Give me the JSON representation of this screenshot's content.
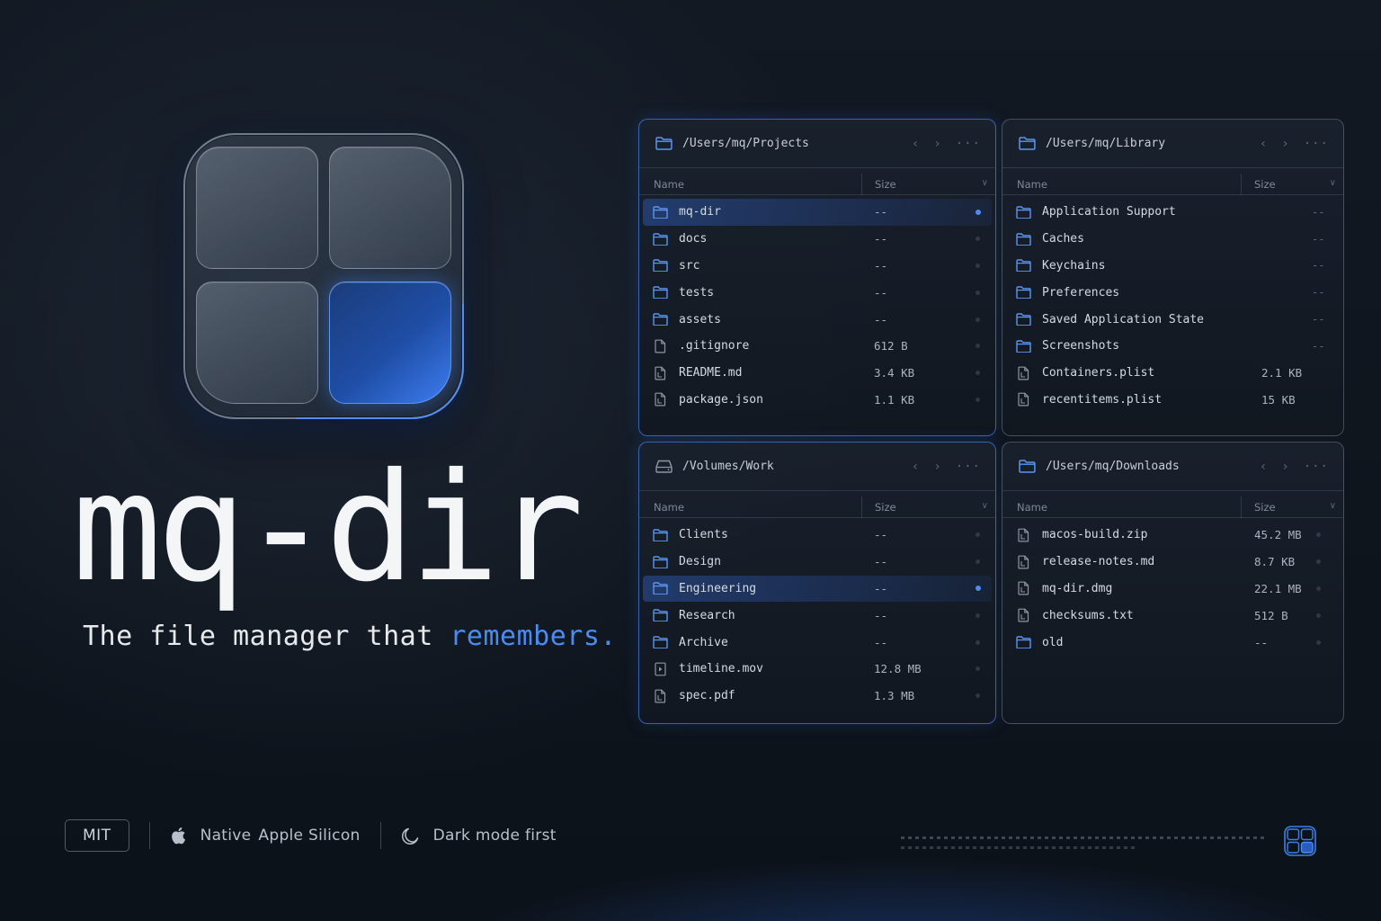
{
  "brand": {
    "name": "mq-dir",
    "tagline_prefix": "The file manager that ",
    "tagline_accent": "remembers."
  },
  "footer": {
    "license_badge": "MIT",
    "feature_1_a": "Native",
    "feature_1_b": "Apple Silicon",
    "feature_2": "Dark mode first"
  },
  "columns": {
    "name": "Name",
    "size": "Size"
  },
  "panes": [
    {
      "path": "/Users/mq/Projects",
      "icon": "folder-icon",
      "active": true,
      "rows": [
        {
          "name": "mq-dir",
          "size": "--",
          "kind": "folder",
          "selected": true
        },
        {
          "name": "docs",
          "size": "--",
          "kind": "folder"
        },
        {
          "name": "src",
          "size": "--",
          "kind": "folder"
        },
        {
          "name": "tests",
          "size": "--",
          "kind": "folder"
        },
        {
          "name": "assets",
          "size": "--",
          "kind": "folder"
        },
        {
          "name": ".gitignore",
          "size": "612 B",
          "kind": "file"
        },
        {
          "name": "README.md",
          "size": "3.4 KB",
          "kind": "doc"
        },
        {
          "name": "package.json",
          "size": "1.1 KB",
          "kind": "doc"
        }
      ]
    },
    {
      "path": "/Users/mq/Library",
      "icon": "folder-icon",
      "active": false,
      "rows": [
        {
          "name": "Application Support",
          "size": "--",
          "kind": "folder"
        },
        {
          "name": "Caches",
          "size": "--",
          "kind": "folder"
        },
        {
          "name": "Keychains",
          "size": "--",
          "kind": "folder"
        },
        {
          "name": "Preferences",
          "size": "--",
          "kind": "folder"
        },
        {
          "name": "Saved Application State",
          "size": "--",
          "kind": "folder"
        },
        {
          "name": "Screenshots",
          "size": "--",
          "kind": "folder"
        },
        {
          "name": "Containers.plist",
          "size": "2.1 KB",
          "kind": "doc"
        },
        {
          "name": "recentitems.plist",
          "size": "15 KB",
          "kind": "doc"
        }
      ]
    },
    {
      "path": "/Volumes/Work",
      "icon": "drive-icon",
      "active": true,
      "rows": [
        {
          "name": "Clients",
          "size": "--",
          "kind": "folder"
        },
        {
          "name": "Design",
          "size": "--",
          "kind": "folder"
        },
        {
          "name": "Engineering",
          "size": "--",
          "kind": "folder",
          "selected": true
        },
        {
          "name": "Research",
          "size": "--",
          "kind": "folder"
        },
        {
          "name": "Archive",
          "size": "--",
          "kind": "folder"
        },
        {
          "name": "timeline.mov",
          "size": "12.8 MB",
          "kind": "video"
        },
        {
          "name": "spec.pdf",
          "size": "1.3 MB",
          "kind": "doc"
        }
      ]
    },
    {
      "path": "/Users/mq/Downloads",
      "icon": "folder-icon",
      "active": false,
      "rows": [
        {
          "name": "macos-build.zip",
          "size": "45.2 MB",
          "kind": "doc"
        },
        {
          "name": "release-notes.md",
          "size": "8.7 KB",
          "kind": "doc"
        },
        {
          "name": "mq-dir.dmg",
          "size": "22.1 MB",
          "kind": "doc"
        },
        {
          "name": "checksums.txt",
          "size": "512 B",
          "kind": "doc"
        },
        {
          "name": "old",
          "size": "--",
          "kind": "folder"
        }
      ]
    }
  ],
  "colors": {
    "accent": "#4a8cf2",
    "background": "#111821",
    "text": "#f4f5f7"
  }
}
